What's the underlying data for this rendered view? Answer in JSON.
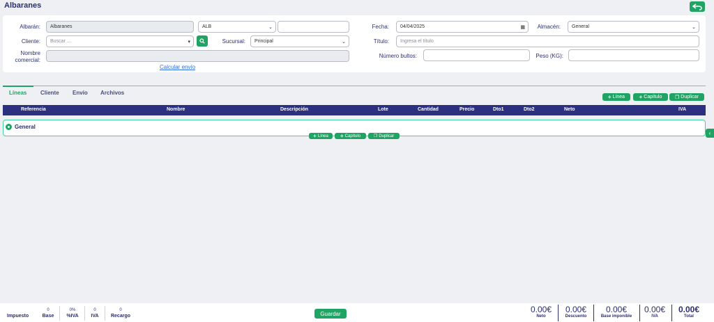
{
  "page": {
    "title": "Albaranes"
  },
  "form": {
    "albaran_label": "Albarán:",
    "albaran_value": "Albaranes",
    "serie_value": "ALB",
    "numero_value": "",
    "cliente_label": "Cliente:",
    "cliente_placeholder": "Buscar ...",
    "sucursal_label": "Sucursal:",
    "sucursal_value": "Principal",
    "nombre_comercial_label_1": "Nombre",
    "nombre_comercial_label_2": "comercial:",
    "nombre_comercial_value": "",
    "calcular_envio": "Calcular envío",
    "fecha_label": "Fecha:",
    "fecha_value": "04/04/2025",
    "almacen_label": "Almacén:",
    "almacen_value": "General",
    "titulo_label": "Título:",
    "titulo_placeholder": "Ingresa el título",
    "bultos_label": "Número bultos:",
    "bultos_value": "",
    "peso_label": "Peso (KG):",
    "peso_value": ""
  },
  "tabs": [
    {
      "label": "Líneas",
      "active": true
    },
    {
      "label": "Cliente",
      "active": false
    },
    {
      "label": "Envío",
      "active": false
    },
    {
      "label": "Archivos",
      "active": false
    }
  ],
  "toolbar": {
    "linea": "Línea",
    "capitulo": "Capítulo",
    "duplicar": "Duplicar"
  },
  "table": {
    "headers": [
      "Referencia",
      "Nombre",
      "Descripción",
      "Lote",
      "Cantidad",
      "Precio",
      "Dto1",
      "Dto2",
      "Neto",
      "IVA"
    ],
    "group": "General"
  },
  "footer": {
    "impuesto": "Impuesto",
    "base_label": "Base",
    "base_value": "0",
    "piva_label": "%IVA",
    "piva_value": "0%",
    "iva_label": "IVA",
    "iva_value": "0",
    "recargo_label": "Recargo",
    "recargo_value": "0",
    "save": "Guardar",
    "totals": [
      {
        "value": "0.00€",
        "label": "Neto"
      },
      {
        "value": "0.00€",
        "label": "Descuento"
      },
      {
        "value": "0.00€",
        "label": "Base imponible"
      },
      {
        "value": "0.00€",
        "label": "IVA"
      },
      {
        "value": "0.00€",
        "label": "Total"
      }
    ]
  },
  "colors": {
    "accent": "#1fa463",
    "header": "#2b3180",
    "text": "#2b2f6b"
  }
}
